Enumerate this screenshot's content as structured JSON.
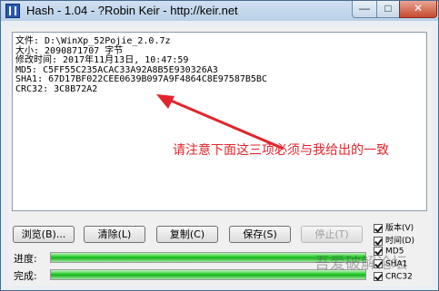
{
  "window": {
    "title": "Hash - 1.04 - ?Robin Keir - http://keir.net",
    "minimize_glyph": "—",
    "maximize_glyph": "□",
    "close_glyph": "✕",
    "app_icon": "hash-app-icon"
  },
  "output": {
    "lines": [
      "文件: D:\\WinXp_52Pojie_2.0.7z",
      "大小: 2090871707 字节",
      "修改时间: 2017年11月13日, 10:47:59",
      "MD5: C5FF55C235ACAC33A92A8B5E930326A3",
      "SHA1: 67D17BF022CEE0639B097A9F4864C8E97587B5BC",
      "CRC32: 3C8B72A2"
    ]
  },
  "annotation": {
    "text": "请注意下面这三项必须与我给出的一致",
    "color": "#e3242b"
  },
  "buttons": {
    "browse": "浏览(B)...",
    "clear": "清除(L)",
    "copy": "复制(C)",
    "save": "保存(S)",
    "stop": "停止(T)"
  },
  "checkboxes": [
    {
      "label": "版本(V)",
      "checked": true
    },
    {
      "label": "时间(D)",
      "checked": true
    },
    {
      "label": "MD5",
      "checked": true
    },
    {
      "label": "SHA1",
      "checked": true
    },
    {
      "label": "CRC32",
      "checked": true
    }
  ],
  "progress": {
    "process_label": "进度:",
    "process_value": 1.0,
    "done_label": "完成:",
    "done_value": 1.0,
    "fill_color": "#22c927"
  },
  "watermark": "吾爱破解论坛"
}
